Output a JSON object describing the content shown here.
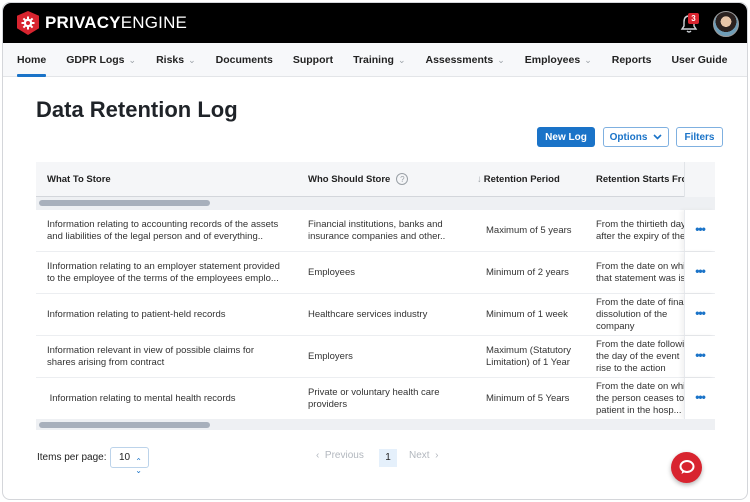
{
  "brand": {
    "name_bold": "PRIVACY",
    "name_regular": "ENGINE"
  },
  "header": {
    "notification_count": "3"
  },
  "nav": {
    "items": [
      {
        "label": "Home",
        "active": true,
        "dropdown": false
      },
      {
        "label": "GDPR Logs",
        "active": false,
        "dropdown": true
      },
      {
        "label": "Risks",
        "active": false,
        "dropdown": true
      },
      {
        "label": "Documents",
        "active": false,
        "dropdown": false
      },
      {
        "label": "Support",
        "active": false,
        "dropdown": false
      },
      {
        "label": "Training",
        "active": false,
        "dropdown": true
      },
      {
        "label": "Assessments",
        "active": false,
        "dropdown": true
      },
      {
        "label": "Employees",
        "active": false,
        "dropdown": true
      },
      {
        "label": "Reports",
        "active": false,
        "dropdown": false
      },
      {
        "label": "User Guide",
        "active": false,
        "dropdown": false
      }
    ],
    "chevron": "⌄"
  },
  "page": {
    "title": "Data Retention Log"
  },
  "toolbar": {
    "new_log_label": "New Log",
    "options_label": "Options",
    "filters_label": "Filters"
  },
  "table": {
    "columns": {
      "what": "What To Store",
      "who": "Who Should Store",
      "who_help": "?",
      "period_sort": "↓",
      "period": "Retention Period",
      "starts": "Retention Starts From"
    },
    "actions_label": "•••",
    "rows": [
      {
        "what": [
          "Information relating to accounting records of the assets",
          "and liabilities of the legal person and of everything.."
        ],
        "who": [
          "Financial institutions, banks and",
          "insurance companies and other.."
        ],
        "period": [
          "Maximum of 5 years"
        ],
        "starts": [
          "From the thirtieth day",
          "after the expiry of the"
        ]
      },
      {
        "what": [
          "IInformation relating to an employer statement provided",
          "to the employee of the terms of the employees emplo..."
        ],
        "who": [
          "Employees"
        ],
        "period": [
          "Minimum of 2 years"
        ],
        "starts": [
          "From the date on which",
          "that statement was is"
        ]
      },
      {
        "what": [
          "Information relating to patient-held records"
        ],
        "who": [
          "Healthcare services industry"
        ],
        "period": [
          "Minimum of 1 week"
        ],
        "starts": [
          "From the date of final",
          "dissolution of the",
          "company"
        ]
      },
      {
        "what": [
          "Information relevant in view of possible claims for",
          "shares arising from contract"
        ],
        "who": [
          "Employers"
        ],
        "period": [
          "Maximum (Statutory",
          "Limitation) of 1 Year"
        ],
        "starts": [
          "From the date following",
          "the day of the event",
          "rise to the action"
        ]
      },
      {
        "what": [
          " Information relating to mental health records"
        ],
        "who": [
          "Private or voluntary health care",
          "providers"
        ],
        "period": [
          "Minimum of 5 Years"
        ],
        "starts": [
          "From the date on which",
          "the person ceases to",
          "patient in the hosp..."
        ]
      }
    ]
  },
  "pagination": {
    "items_per_page_label": "Items per page:",
    "items_per_page_value": "10",
    "previous_label": "Previous",
    "current_page": "1",
    "next_label": "Next"
  },
  "colors": {
    "brand_red": "#d8242f",
    "accent_blue": "#1a73c8"
  }
}
